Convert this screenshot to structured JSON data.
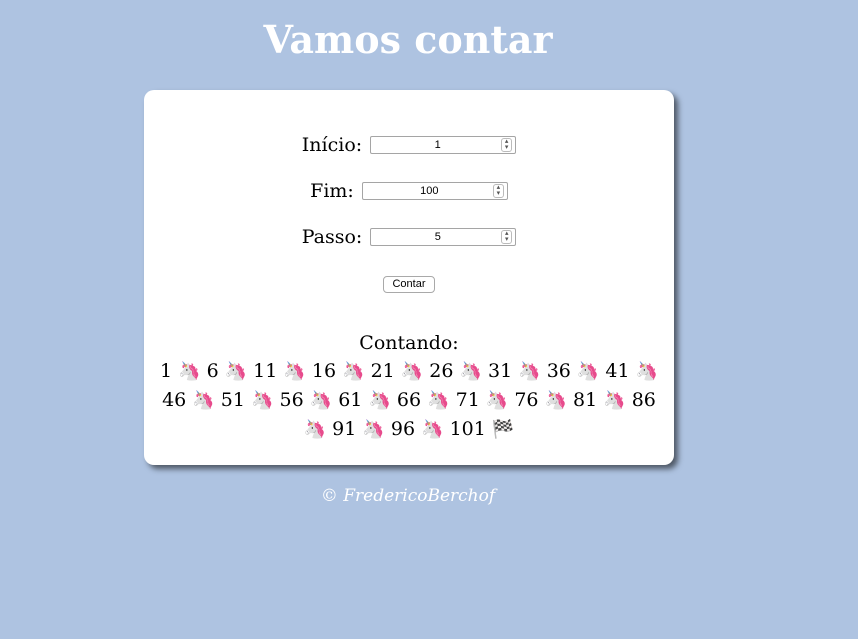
{
  "title": "Vamos contar",
  "form": {
    "inicio": {
      "label": "Início:",
      "value": "1"
    },
    "fim": {
      "label": "Fim:",
      "value": "100"
    },
    "passo": {
      "label": "Passo:",
      "value": "5"
    },
    "button_label": "Contar"
  },
  "result": {
    "heading": "Contando:",
    "numbers": [
      "1",
      "6",
      "11",
      "16",
      "21",
      "26",
      "31",
      "36",
      "41",
      "46",
      "51",
      "56",
      "61",
      "66",
      "71",
      "76",
      "81",
      "86",
      "91",
      "96",
      "101"
    ],
    "separator_icon": "🦄",
    "end_icon": "🏁"
  },
  "footer": "© FredericoBerchof"
}
